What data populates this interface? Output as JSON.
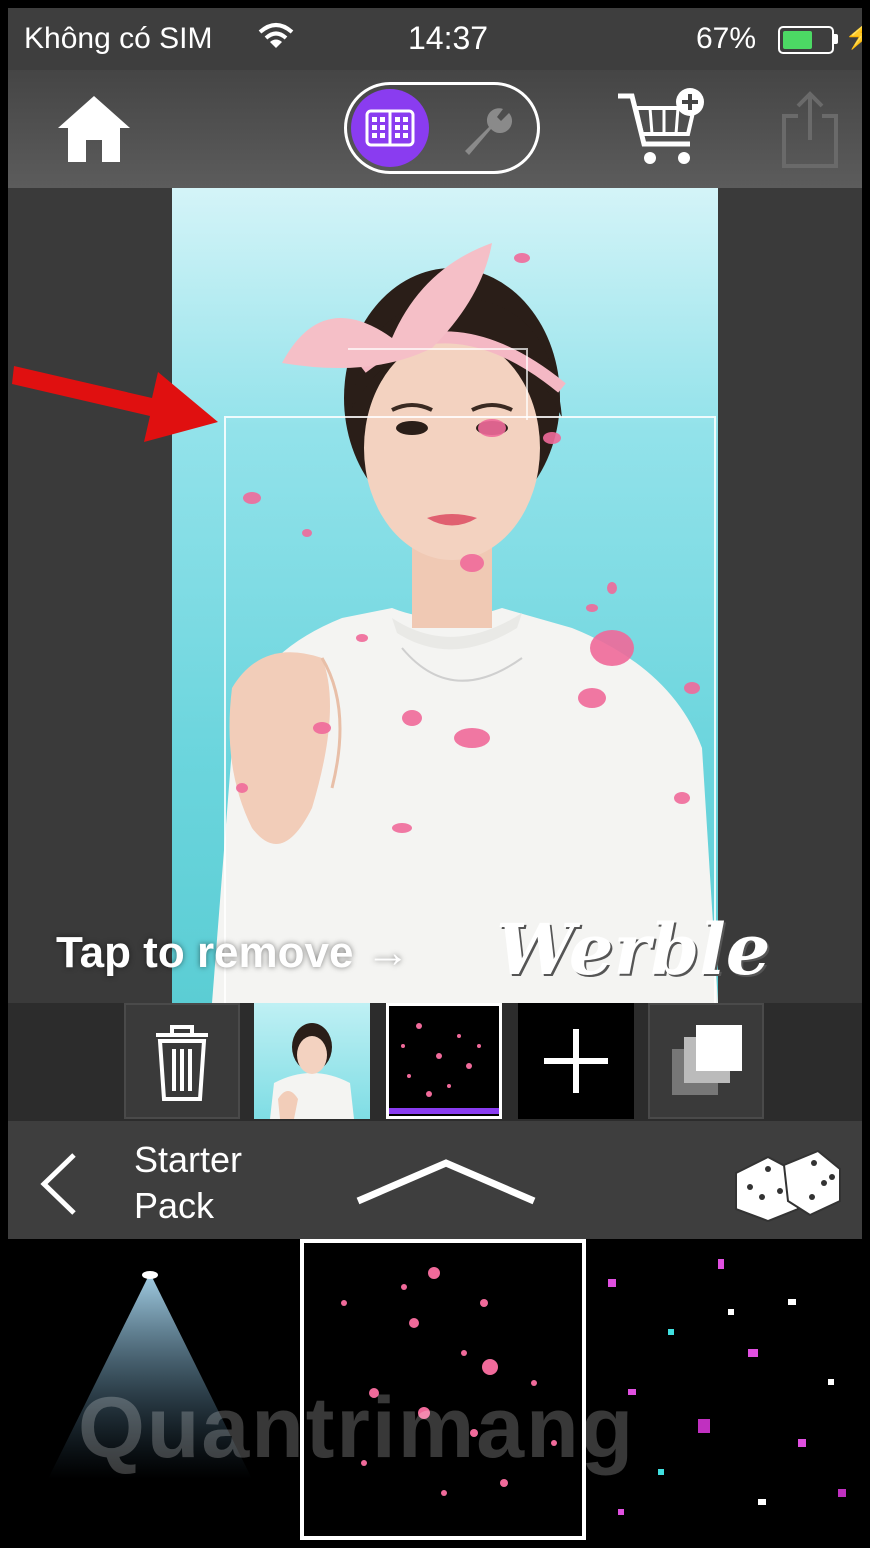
{
  "status_bar": {
    "carrier": "Không có SIM",
    "time": "14:37",
    "battery_percent": "67%",
    "battery_level": 0.67,
    "wifi_icon": "wifi-icon",
    "charging_icon": "charging-bolt-icon"
  },
  "toolbar": {
    "home_icon": "home-icon",
    "mode_toggle": {
      "active": "layers",
      "options": [
        "layers-icon",
        "wrench-icon"
      ]
    },
    "store_icon": "cart-add-icon",
    "share_icon": "share-icon",
    "accent_color": "#8a3cf0"
  },
  "canvas": {
    "hint_text": "Tap to remove →",
    "brand": "Werble"
  },
  "layers": {
    "items": [
      "trash-icon",
      "photo-layer",
      "petals-effect-layer",
      "add-layer",
      "layers-stack-icon"
    ],
    "selected": 2
  },
  "pack_bar": {
    "back_icon": "chevron-left-icon",
    "pack_name_line1": "Starter",
    "pack_name_line2": "Pack",
    "expand_icon": "chevron-up-icon",
    "random_icon": "dice-icon"
  },
  "effects": {
    "items": [
      "spotlight-effect",
      "pink-petals-effect",
      "confetti-effect"
    ],
    "selected": 1
  },
  "watermark": "Quantrimang"
}
